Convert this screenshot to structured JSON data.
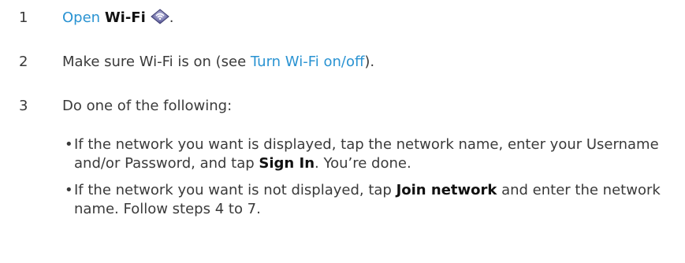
{
  "steps": [
    {
      "number": "1",
      "open_link": "Open",
      "app_name": "Wi-Fi",
      "icon": "wifi-app-icon",
      "period": "."
    },
    {
      "number": "2",
      "prefix": "Make sure Wi-Fi is on (see ",
      "link": "Turn Wi-Fi on/off",
      "suffix": ")."
    },
    {
      "number": "3",
      "text": "Do one of the following:"
    }
  ],
  "bullets": [
    {
      "bullet": "•",
      "pre": "If the network you want is displayed, tap the network name, enter your Username and/or Password, and tap ",
      "bold": "Sign In",
      "post": ". You’re done."
    },
    {
      "bullet": "•",
      "pre": "If the network you want is not displayed, tap ",
      "bold": "Join network",
      "post": " and enter the network name. Follow steps 4 to 7."
    }
  ],
  "colors": {
    "link": "#2a93d2",
    "body_text": "#3a3a3a",
    "bold_text": "#111111"
  }
}
